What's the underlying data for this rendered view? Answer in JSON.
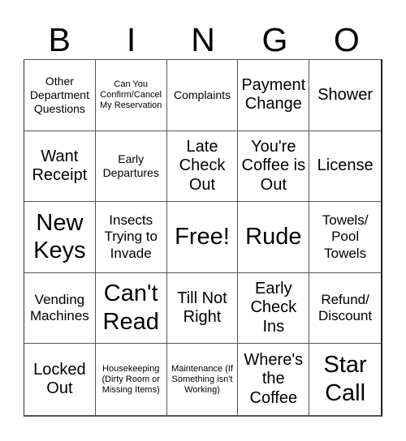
{
  "header": {
    "letters": [
      "B",
      "I",
      "N",
      "G",
      "O"
    ]
  },
  "cells": [
    {
      "text": "Other Department Questions",
      "size": "fs-s"
    },
    {
      "text": "Can You Confirm/Cancel My Reservation",
      "size": "fs-xs"
    },
    {
      "text": "Complaints",
      "size": "fs-s"
    },
    {
      "text": "Payment Change",
      "size": "fs-l"
    },
    {
      "text": "Shower",
      "size": "fs-l"
    },
    {
      "text": "Want Receipt",
      "size": "fs-l"
    },
    {
      "text": "Early Departures",
      "size": "fs-s"
    },
    {
      "text": "Late Check Out",
      "size": "fs-l"
    },
    {
      "text": "You're Coffee is Out",
      "size": "fs-l"
    },
    {
      "text": "License",
      "size": "fs-l"
    },
    {
      "text": "New Keys",
      "size": "fs-xl"
    },
    {
      "text": "Insects Trying to Invade",
      "size": "fs-m"
    },
    {
      "text": "Free!",
      "size": "fs-xl"
    },
    {
      "text": "Rude",
      "size": "fs-xl"
    },
    {
      "text": "Towels/ Pool Towels",
      "size": "fs-m"
    },
    {
      "text": "Vending Machines",
      "size": "fs-m"
    },
    {
      "text": "Can't Read",
      "size": "fs-xl"
    },
    {
      "text": "Till Not Right",
      "size": "fs-l"
    },
    {
      "text": "Early Check Ins",
      "size": "fs-l"
    },
    {
      "text": "Refund/ Discount",
      "size": "fs-m"
    },
    {
      "text": "Locked Out",
      "size": "fs-l"
    },
    {
      "text": "Housekeeping (Dirty Room or Missing Items)",
      "size": "fs-xs"
    },
    {
      "text": "Maintenance (If Something isn't Working)",
      "size": "fs-xs"
    },
    {
      "text": "Where's the Coffee",
      "size": "fs-l"
    },
    {
      "text": "Star Call",
      "size": "fs-xl"
    }
  ]
}
